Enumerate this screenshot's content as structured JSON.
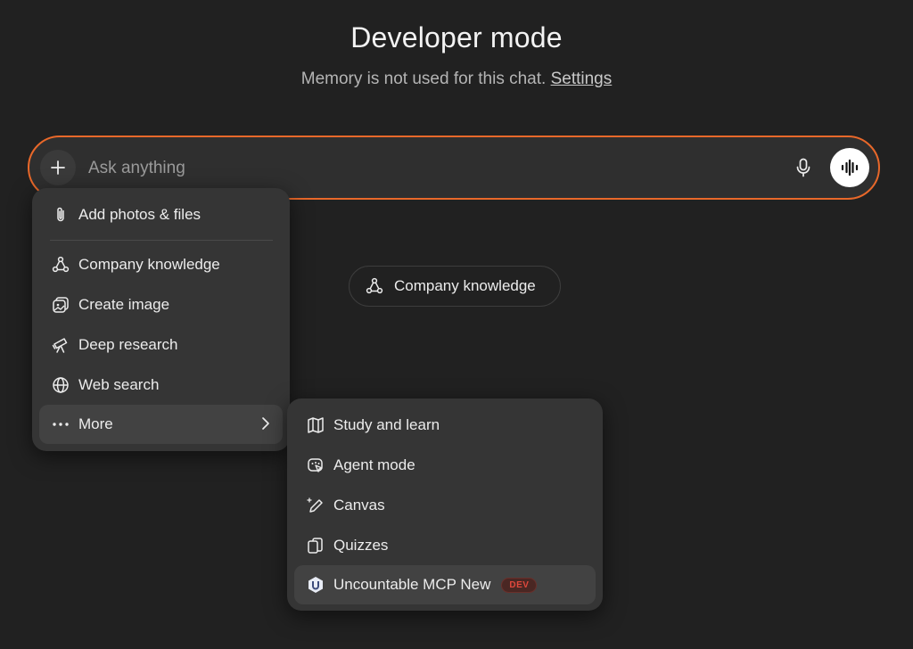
{
  "header": {
    "title": "Developer mode",
    "subtitle": "Memory is not used for this chat.",
    "settings_link": "Settings"
  },
  "composer": {
    "placeholder": "Ask anything",
    "value": ""
  },
  "pill": {
    "label": "Company knowledge"
  },
  "main_menu": {
    "items": [
      {
        "label": "Add photos & files",
        "icon": "paperclip-icon"
      },
      {
        "label": "Company knowledge",
        "icon": "company-knowledge-icon"
      },
      {
        "label": "Create image",
        "icon": "image-icon"
      },
      {
        "label": "Deep research",
        "icon": "telescope-icon"
      },
      {
        "label": "Web search",
        "icon": "globe-icon"
      },
      {
        "label": "More",
        "icon": "ellipsis-icon"
      }
    ]
  },
  "more_menu": {
    "items": [
      {
        "label": "Study and learn",
        "icon": "book-icon"
      },
      {
        "label": "Agent mode",
        "icon": "agent-icon"
      },
      {
        "label": "Canvas",
        "icon": "pencil-icon"
      },
      {
        "label": "Quizzes",
        "icon": "cards-icon"
      },
      {
        "label": "Uncountable MCP New",
        "icon": "uncountable-logo-icon",
        "badge": "DEV"
      }
    ]
  },
  "colors": {
    "background": "#212121",
    "accent_border": "#e8682a",
    "menu_bg": "#353535",
    "badge_text": "#e0483c"
  }
}
